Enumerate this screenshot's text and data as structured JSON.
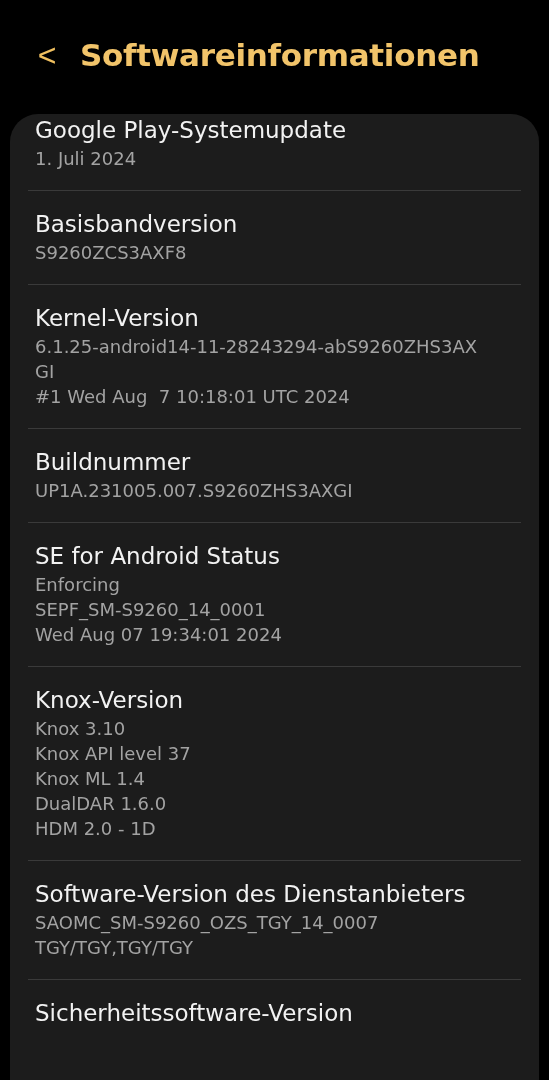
{
  "header": {
    "back": "<",
    "title": "Softwareinformationen"
  },
  "items": [
    {
      "title": "Google Play-Systemupdate",
      "values": [
        "1. Juli 2024"
      ]
    },
    {
      "title": "Basisbandversion",
      "values": [
        "S9260ZCS3AXF8"
      ]
    },
    {
      "title": "Kernel-Version",
      "values": [
        "6.1.25-android14-11-28243294-abS9260ZHS3AX",
        "GI",
        "#1 Wed Aug  7 10:18:01 UTC 2024"
      ]
    },
    {
      "title": "Buildnummer",
      "values": [
        "UP1A.231005.007.S9260ZHS3AXGI"
      ]
    },
    {
      "title": "SE for Android Status",
      "values": [
        "Enforcing",
        "SEPF_SM-S9260_14_0001",
        "Wed Aug 07 19:34:01 2024"
      ]
    },
    {
      "title": "Knox-Version",
      "values": [
        "Knox 3.10",
        "Knox API level 37",
        "Knox ML 1.4",
        "DualDAR 1.6.0",
        "HDM 2.0 - 1D"
      ]
    },
    {
      "title": "Software-Version des Dienstanbieters",
      "values": [
        "SAOMC_SM-S9260_OZS_TGY_14_0007",
        "TGY/TGY,TGY/TGY"
      ]
    },
    {
      "title": "Sicherheitssoftware-Version"
    }
  ]
}
